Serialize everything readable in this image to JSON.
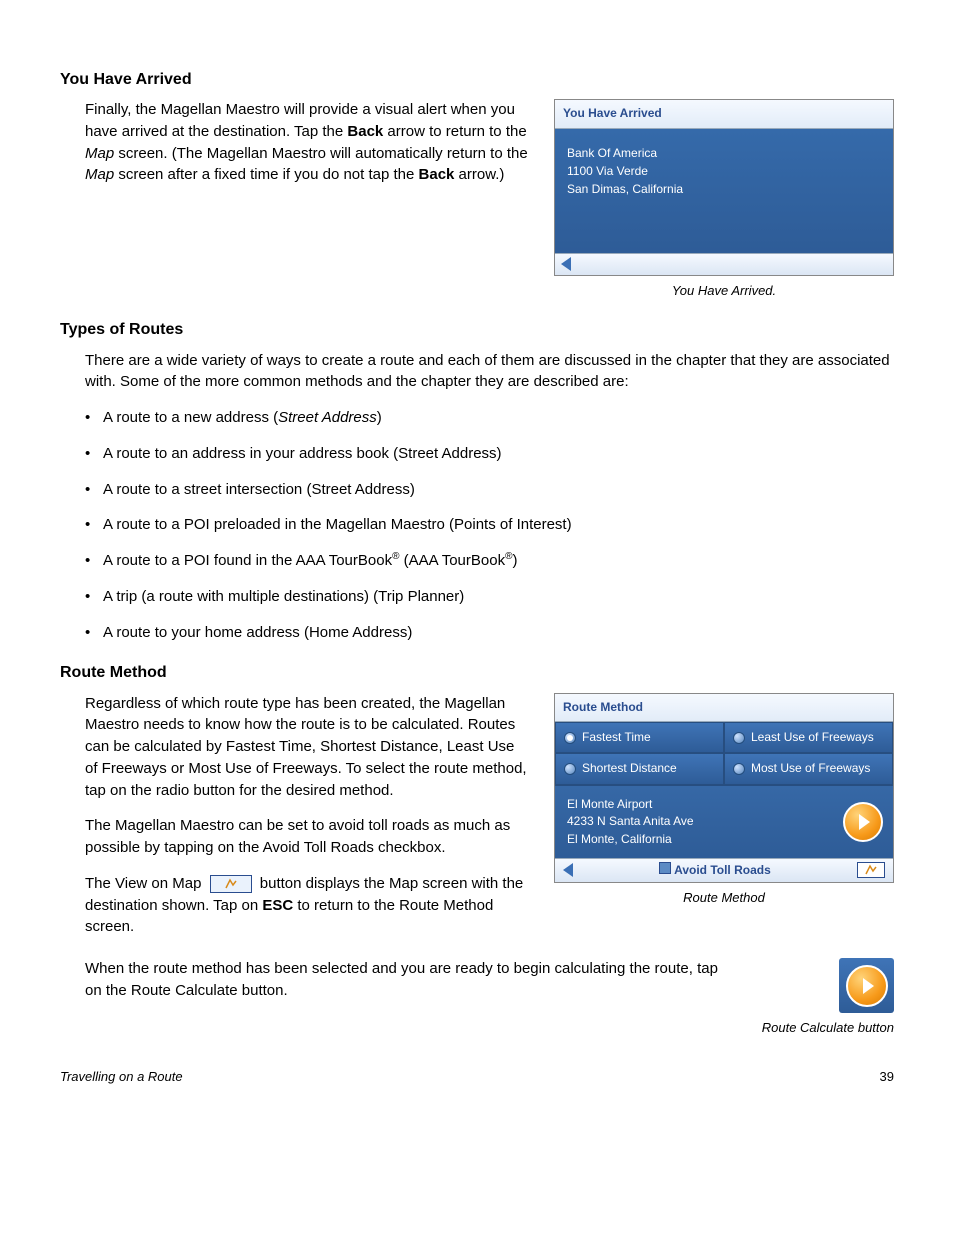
{
  "sections": {
    "arrived": {
      "heading": "You Have Arrived",
      "para_before_back": "Finally, the Magellan Maestro will provide a visual alert when you have arrived at the destination.  Tap the ",
      "back_word": "Back",
      "para_mid_1": " arrow to return to the ",
      "map_word": "Map",
      "para_mid_2": " screen.  (The Magellan Maestro will automatically return to the ",
      "para_mid_3": " screen after a fixed time if you do not tap the ",
      "para_end": " arrow.)",
      "panel": {
        "title": "You Have Arrived",
        "line1": "Bank Of America",
        "line2": "1100 Via Verde",
        "line3": "San Dimas, California"
      },
      "caption": "You Have Arrived."
    },
    "types": {
      "heading": "Types of Routes",
      "intro": "There are a wide variety of ways to create a route and each of them are discussed in the chapter that they are associated with.   Some of the more common methods and the chapter they are described are:",
      "items": [
        {
          "prefix": "A route to a new address  (",
          "italic": "Street Address",
          "suffix": ")"
        },
        {
          "text": "A route to an address in your address book (Street Address)"
        },
        {
          "text": "A route to a street intersection (Street Address)"
        },
        {
          "text": "A route to a POI preloaded in the Magellan Maestro (Points of Interest)"
        },
        {
          "tourbook_pre": "A route to a POI found in the AAA TourBook",
          "reg": "®",
          "tourbook_mid": " (AAA TourBook",
          "tourbook_suf": ")"
        },
        {
          "text": "A trip (a route with multiple destinations) (Trip Planner)"
        },
        {
          "text": "A route to your home address (Home Address)"
        }
      ]
    },
    "method": {
      "heading": "Route Method",
      "para1": "Regardless of which route type has been created, the Magellan Maestro needs to know how the route is to be calculated.  Routes can be calculated by Fastest Time, Shortest Distance, Least Use of Freeways or Most Use of Freeways.  To select the route method, tap on the radio button for the desired method.",
      "para2": "The Magellan Maestro can be set to avoid toll roads as much as possible by tapping on the Avoid Toll Roads checkbox.",
      "para3_pre": "The View on Map ",
      "para3_mid": " button displays the Map screen with the destination shown.  Tap on ",
      "esc": "ESC",
      "para3_suf": " to return to the Route Method screen.",
      "para4": "When the route method has been selected and you are ready to begin calculating the route, tap on the Route Calculate button.",
      "panel": {
        "title": "Route Method",
        "opt1": "Fastest Time",
        "opt2": "Least Use of Freeways",
        "opt3": "Shortest Distance",
        "opt4": "Most Use of Freeways",
        "dest1": "El Monte Airport",
        "dest2": "4233 N Santa Anita Ave",
        "dest3": "El Monte, California",
        "avoid": "Avoid Toll Roads"
      },
      "caption": "Route Method",
      "caption2": "Route Calculate button"
    }
  },
  "footer": {
    "title": "Travelling on a Route",
    "page": "39"
  }
}
